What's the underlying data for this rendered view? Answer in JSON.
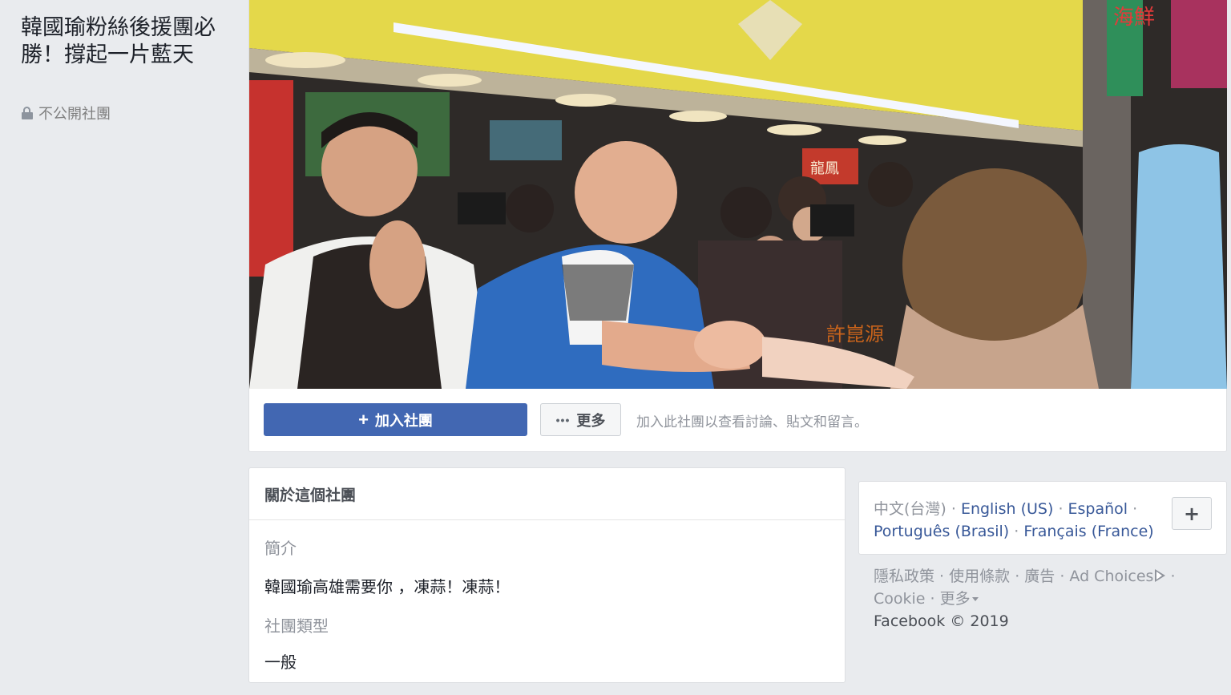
{
  "group": {
    "title": "韓國瑜粉絲後援團必勝！撐起一片藍天",
    "privacy": "不公開社團"
  },
  "cover": {
    "join_label": "加入社團",
    "more_label": "更多",
    "hint": "加入此社團以查看討論、貼文和留言。",
    "sign_text": "海鮮"
  },
  "about": {
    "header": "關於這個社團",
    "intro_label": "簡介",
    "intro_value": "韓國瑜高雄需要你 ，凍蒜！凍蒜！",
    "type_label": "社團類型",
    "type_value": "一般"
  },
  "languages": {
    "current": "中文(台灣)",
    "items": [
      "English (US)",
      "Español",
      "Português (Brasil)",
      "Français (France)"
    ],
    "sep": " · "
  },
  "footer": {
    "privacy": "隱私政策",
    "terms": "使用條款",
    "ads": "廣告",
    "ad_choices": "Ad Choices",
    "cookie": "Cookie",
    "more": "更多",
    "copyright": "Facebook © 2019"
  },
  "colors": {
    "brand": "#4267b2",
    "link": "#385898",
    "background": "#e9ebee"
  }
}
